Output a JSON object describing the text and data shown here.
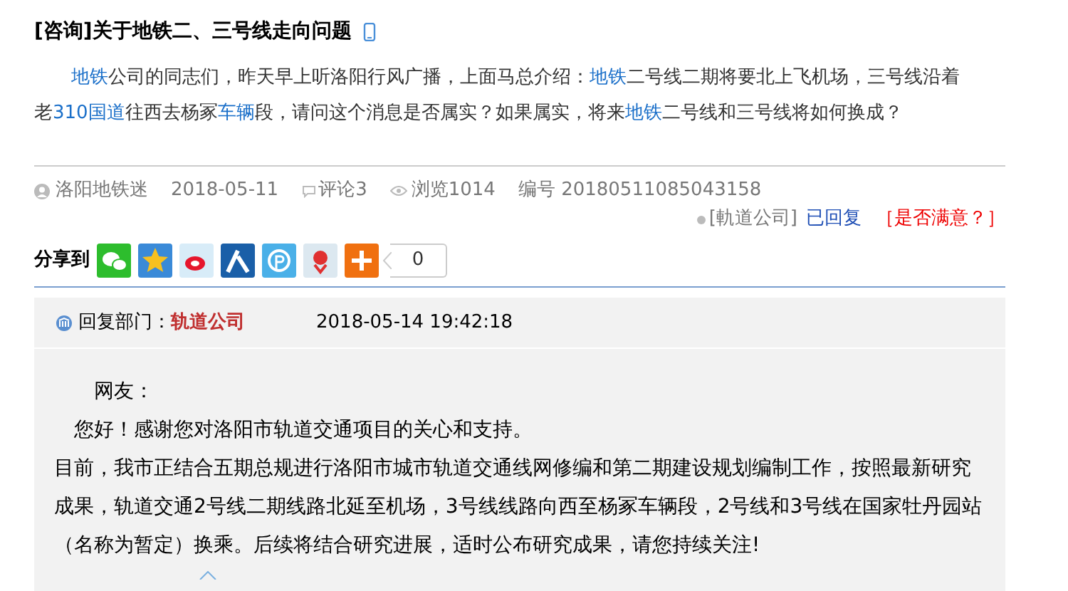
{
  "question": {
    "tag": "[咨询]",
    "title": "关于地铁二、三号线走向问题",
    "segments": [
      {
        "text": "地铁",
        "link": true
      },
      {
        "text": "公司的同志们，昨天早上听洛阳行风广播，上面马总介绍：",
        "link": false
      },
      {
        "text": "地铁",
        "link": true
      },
      {
        "text": "二号线二期将要北上飞机场，三号线沿着老",
        "link": false
      },
      {
        "text": "310国道",
        "link": true
      },
      {
        "text": "往西去杨冢",
        "link": false
      },
      {
        "text": "车辆",
        "link": true
      },
      {
        "text": "段，请问这个消息是否属实？如果属实，将来",
        "link": false
      },
      {
        "text": "地铁",
        "link": true
      },
      {
        "text": "二号线和三号线将如何换成？",
        "link": false
      }
    ]
  },
  "meta": {
    "author": "洛阳地铁迷",
    "date": "2018-05-11",
    "comments": "评论3",
    "views": "浏览1014",
    "number": "编号 20180511085043158"
  },
  "status": {
    "department": "[軌道公司]",
    "state": "已回复",
    "satisfaction": "［是否满意？］"
  },
  "share": {
    "label": "分享到",
    "count": "0"
  },
  "reply": {
    "label": "回复部门：",
    "department": "轨道公司",
    "time": "2018-05-14 19:42:18",
    "paragraphs": [
      {
        "kind": "salutation",
        "text": "网友："
      },
      {
        "kind": "greeting",
        "text": "您好！感谢您对洛阳市轨道交通项目的关心和支持。"
      },
      {
        "kind": "body",
        "text": "目前，我市正结合五期总规进行洛阳市城市轨道交通线网修编和第二期建设规划编制工作，按照最新研究成果，轨道交通2号线二期线路北延至机场，3号线线路向西至杨冢车辆段，2号线和3号线在国家牡丹园站（名称为暂定）换乘。后续将结合研究进展，适时公布研究成果，请您持续关注!"
      }
    ]
  }
}
